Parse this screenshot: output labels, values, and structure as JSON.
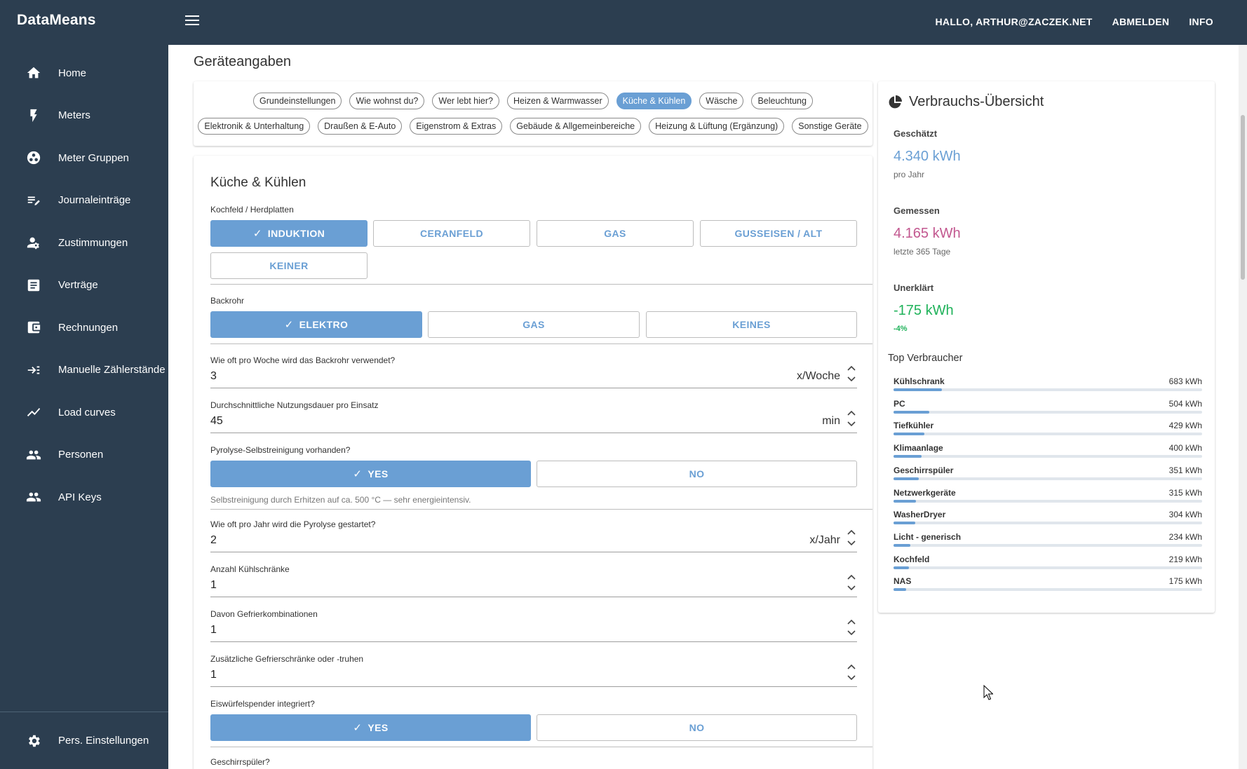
{
  "app": {
    "brand": "DataMeans"
  },
  "topnav": {
    "greeting": "HALLO, ARTHUR@ZACZEK.NET",
    "logout": "ABMELDEN",
    "info": "INFO"
  },
  "sidebar": {
    "items": [
      {
        "label": "Home",
        "icon": "home-icon"
      },
      {
        "label": "Meters",
        "icon": "lightning-icon"
      },
      {
        "label": "Meter Gruppen",
        "icon": "group-icon"
      },
      {
        "label": "Journaleinträge",
        "icon": "journal-edit-icon"
      },
      {
        "label": "Zustimmungen",
        "icon": "consent-icon"
      },
      {
        "label": "Verträge",
        "icon": "contract-icon"
      },
      {
        "label": "Rechnungen",
        "icon": "invoice-icon"
      },
      {
        "label": "Manuelle Zählerstände",
        "icon": "manual-input-icon"
      },
      {
        "label": "Load curves",
        "icon": "chart-line-icon"
      },
      {
        "label": "Personen",
        "icon": "people-icon"
      },
      {
        "label": "API Keys",
        "icon": "people-icon"
      }
    ],
    "bottom": {
      "label": "Pers. Einstellungen",
      "icon": "gear-icon"
    }
  },
  "page": {
    "title": "Geräteangaben"
  },
  "tabs": {
    "row1": [
      "Grundeinstellungen",
      "Wie wohnst du?",
      "Wer lebt hier?",
      "Heizen & Warmwasser",
      "Küche & Kühlen",
      "Wäsche",
      "Beleuchtung"
    ],
    "row2": [
      "Elektronik & Unterhaltung",
      "Draußen & E-Auto",
      "Eigenstrom & Extras",
      "Gebäude & Allgemeinbereiche",
      "Heizung & Lüftung (Ergänzung)",
      "Sonstige Geräte"
    ],
    "active": "Küche & Kühlen"
  },
  "form": {
    "section_title": "Küche & Kühlen",
    "kochfeld": {
      "label": "Kochfeld / Herdplatten",
      "options": [
        "INDUKTION",
        "CERANFELD",
        "GAS",
        "GUSSEISEN / ALT",
        "KEINER"
      ],
      "selected": "INDUKTION"
    },
    "backrohr": {
      "label": "Backrohr",
      "options": [
        "ELEKTRO",
        "GAS",
        "KEINES"
      ],
      "selected": "ELEKTRO"
    },
    "backrohr_freq": {
      "label": "Wie oft pro Woche wird das Backrohr verwendet?",
      "value": "3",
      "unit": "x/Woche"
    },
    "nutzungsdauer": {
      "label": "Durchschnittliche Nutzungsdauer pro Einsatz",
      "value": "45",
      "unit": "min"
    },
    "pyrolyse": {
      "label": "Pyrolyse-Selbstreinigung vorhanden?",
      "options": [
        "YES",
        "NO"
      ],
      "selected": "YES",
      "hint": "Selbstreinigung durch Erhitzen auf ca. 500 °C — sehr energieintensiv."
    },
    "pyrolyse_freq": {
      "label": "Wie oft pro Jahr wird die Pyrolyse gestartet?",
      "value": "2",
      "unit": "x/Jahr"
    },
    "kuehlschraenke": {
      "label": "Anzahl Kühlschränke",
      "value": "1"
    },
    "gefrierkombi": {
      "label": "Davon Gefrierkombinationen",
      "value": "1"
    },
    "gefrierschraenke": {
      "label": "Zusätzliche Gefrierschränke oder -truhen",
      "value": "1"
    },
    "eiswuerfel": {
      "label": "Eiswürfelspender integriert?",
      "options": [
        "YES",
        "NO"
      ],
      "selected": "YES"
    },
    "geschirrspueler": {
      "label": "Geschirrspüler?"
    }
  },
  "summary": {
    "title": "Verbrauchs-Übersicht",
    "geschaetzt": {
      "label": "Geschätzt",
      "value": "4.340 kWh",
      "sub": "pro Jahr",
      "color": "#6a9fd4"
    },
    "gemessen": {
      "label": "Gemessen",
      "value": "4.165 kWh",
      "sub": "letzte 365 Tage",
      "color": "#c2578f"
    },
    "unerklaert": {
      "label": "Unerklärt",
      "value": "-175 kWh",
      "sub": "-4%",
      "color": "#1fb25a"
    },
    "top_title": "Top Verbraucher",
    "consumers": [
      {
        "name": "Kühlschrank",
        "value": "683 kWh",
        "fraction": 0.157
      },
      {
        "name": "PC",
        "value": "504 kWh",
        "fraction": 0.116
      },
      {
        "name": "Tiefkühler",
        "value": "429 kWh",
        "fraction": 0.099
      },
      {
        "name": "Klimaanlage",
        "value": "400 kWh",
        "fraction": 0.092
      },
      {
        "name": "Geschirrspüler",
        "value": "351 kWh",
        "fraction": 0.081
      },
      {
        "name": "Netzwerkgeräte",
        "value": "315 kWh",
        "fraction": 0.073
      },
      {
        "name": "WasherDryer",
        "value": "304 kWh",
        "fraction": 0.07
      },
      {
        "name": "Licht - generisch",
        "value": "234 kWh",
        "fraction": 0.054
      },
      {
        "name": "Kochfeld",
        "value": "219 kWh",
        "fraction": 0.05
      },
      {
        "name": "NAS",
        "value": "175 kWh",
        "fraction": 0.04
      }
    ]
  },
  "colors": {
    "nav_bg": "#2c3e50",
    "accent": "#6a9fd4"
  }
}
